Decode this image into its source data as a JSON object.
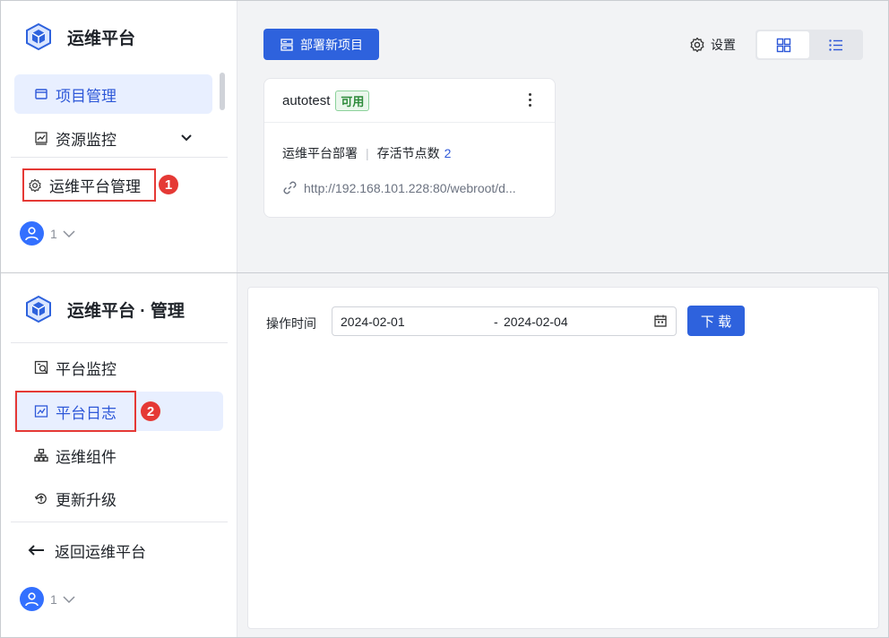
{
  "top": {
    "brand": {
      "title": "运维平台"
    },
    "nav": [
      {
        "label": "项目管理",
        "icon": "folder-icon"
      },
      {
        "label": "资源监控",
        "icon": "chart-icon"
      },
      {
        "label": "运维平台管理",
        "icon": "gear-icon"
      }
    ],
    "callout_number": "1",
    "user": {
      "name": "1"
    },
    "toolbar": {
      "deploy_label": "部署新项目",
      "settings_label": "设置"
    },
    "view_modes": [
      "grid-view-icon",
      "list-view-icon"
    ],
    "project_card": {
      "name": "autotest",
      "status": "可用",
      "type": "运维平台部署",
      "nodes_label": "存活节点数",
      "nodes_count": "2",
      "url": "http://192.168.101.228:80/webroot/d..."
    }
  },
  "bottom": {
    "brand": {
      "title": "运维平台 · 管理"
    },
    "nav": [
      {
        "label": "平台监控",
        "icon": "monitor-icon"
      },
      {
        "label": "平台日志",
        "icon": "log-icon"
      },
      {
        "label": "运维组件",
        "icon": "components-icon"
      },
      {
        "label": "更新升级",
        "icon": "upgrade-icon"
      }
    ],
    "back_label": "返回运维平台",
    "callout_number": "2",
    "user": {
      "name": "1"
    },
    "filter": {
      "label": "操作时间",
      "start": "2024-02-01",
      "separator": "-",
      "end": "2024-02-04",
      "download_label": "下 载"
    }
  },
  "colors": {
    "primary": "#2e62dd",
    "active_bg": "#e8efff",
    "callout": "#e53935",
    "tag_green": "#2e8b3b"
  }
}
